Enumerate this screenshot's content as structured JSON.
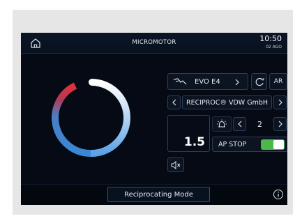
{
  "header": {
    "title": "MICROMOTOR",
    "time": "10:50",
    "date": "02 AGO"
  },
  "file": {
    "name": "EVO E4",
    "mode_label": "AR"
  },
  "manufacturer": {
    "name": "RECIPROC® VDW GmbH"
  },
  "alarm": {
    "level": "2"
  },
  "speed": {
    "value": "1.5"
  },
  "ap_stop": {
    "label": "AP STOP",
    "enabled": true
  },
  "footer": {
    "mode_button": "Reciprocating Mode"
  },
  "colors": {
    "accent_blue": "#3a87d6",
    "accent_red": "#e0303c",
    "toggle_on": "#4bb84a"
  }
}
